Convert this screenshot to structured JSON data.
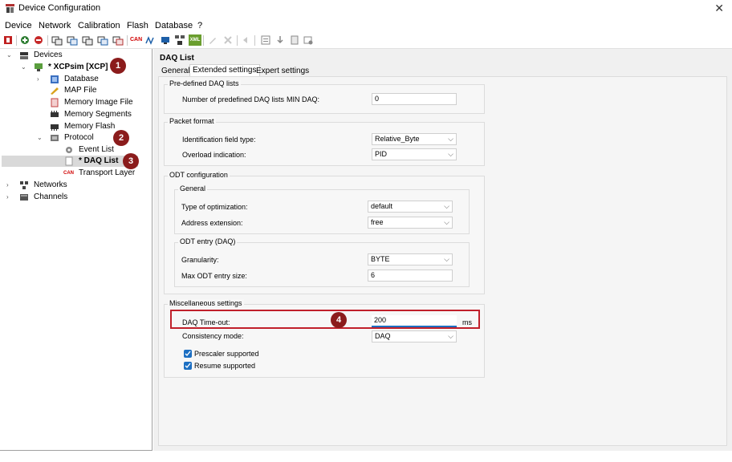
{
  "window": {
    "title": "Device Configuration"
  },
  "menu": [
    "Device",
    "Network",
    "Calibration",
    "Flash",
    "Database",
    "?"
  ],
  "toolbar": {
    "icons": [
      "power-icon",
      "add-device-icon",
      "remove-device-icon",
      "device-a-icon",
      "device-b-icon",
      "device-c-icon",
      "device-d-icon",
      "device-e-icon",
      "can-icon",
      "signal-icon",
      "network-icon",
      "network-device-icon",
      "xml-icon",
      "pencil-icon",
      "delete-icon",
      "back-icon",
      "list-icon",
      "download-icon",
      "page-icon",
      "settings-icon"
    ],
    "can_label": "CAN",
    "xml_label": "XML"
  },
  "tree": {
    "devices": "Devices",
    "xcpsim": "* XCPsim [XCP]",
    "database": "Database",
    "map_file": "MAP File",
    "memory_image": "Memory Image File",
    "memory_segments": "Memory Segments",
    "memory_flash": "Memory Flash",
    "protocol": "Protocol",
    "event_list": "Event List",
    "daq_list": "* DAQ List",
    "transport_layer": "Transport Layer",
    "transport_icon_label": "CAN",
    "networks": "Networks",
    "channels": "Channels"
  },
  "badges": [
    "1",
    "2",
    "3",
    "4"
  ],
  "panel": {
    "title": "DAQ List",
    "tabs": [
      "General",
      "Extended settings",
      "Expert settings"
    ],
    "active_tab": "Extended settings"
  },
  "predefined": {
    "title": "Pre-defined DAQ lists",
    "label": "Number of predefined DAQ lists",
    "sublabel": "MIN DAQ:",
    "value": "0"
  },
  "packet": {
    "title": "Packet format",
    "id_label": "Identification field type:",
    "id_value": "Relative_Byte",
    "overload_label": "Overload indication:",
    "overload_value": "PID"
  },
  "odt": {
    "title": "ODT configuration",
    "general_title": "General",
    "opt_label": "Type of optimization:",
    "opt_value": "default",
    "addr_label": "Address extension:",
    "addr_value": "free",
    "entry_title": "ODT entry (DAQ)",
    "gran_label": "Granularity:",
    "gran_value": "BYTE",
    "max_label": "Max ODT entry size:",
    "max_value": "6"
  },
  "misc": {
    "title": "Miscellaneous settings",
    "timeout_label": "DAQ Time-out:",
    "timeout_value": "200",
    "timeout_unit": "ms",
    "consistency_label": "Consistency mode:",
    "consistency_value": "DAQ",
    "prescaler_label": "Prescaler supported",
    "prescaler_checked": true,
    "resume_label": "Resume supported",
    "resume_checked": true
  },
  "colors": {
    "badge": "#8b1c1c",
    "highlight": "#c0202b",
    "checkbox": "#1d6fc2",
    "selection": "#d9d9d9"
  }
}
